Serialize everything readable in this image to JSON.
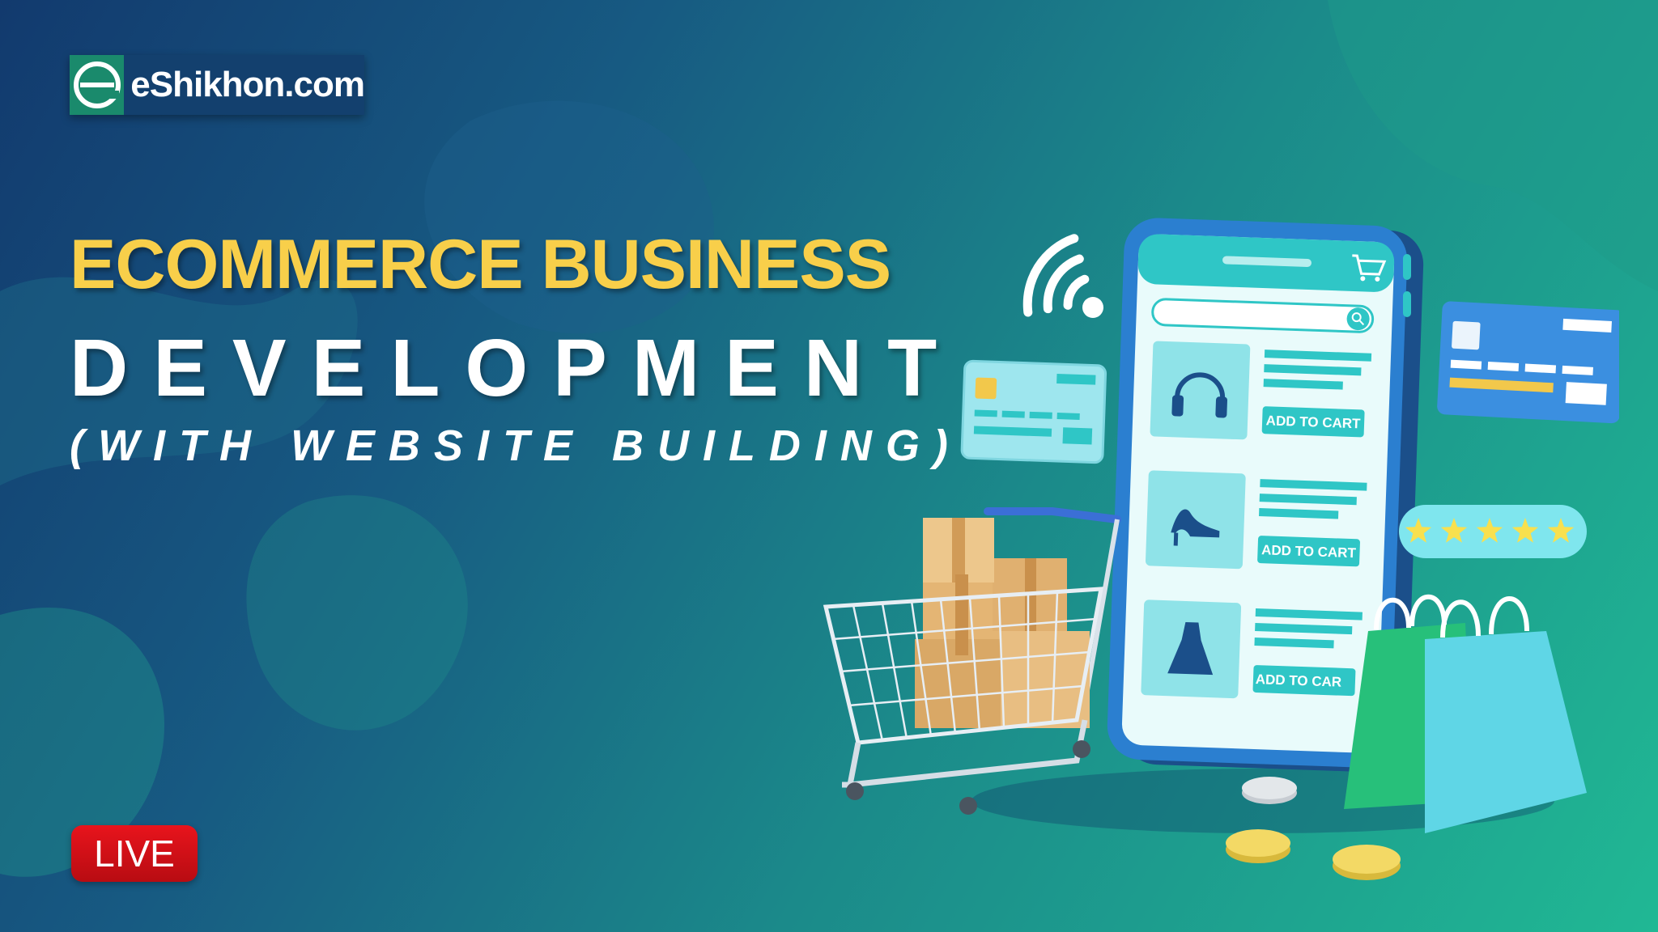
{
  "brand": {
    "logo_text": "eShikhon.com"
  },
  "headline": {
    "line1": "ECOMMERCE BUSINESS",
    "line2": "DEVELOPMENT",
    "line3": "(WITH WEBSITE BUILDING)"
  },
  "badge": {
    "live": "LIVE"
  },
  "phone": {
    "products": [
      {
        "icon": "headphones-icon",
        "button": "ADD TO CART"
      },
      {
        "icon": "high-heel-icon",
        "button": "ADD TO CART"
      },
      {
        "icon": "dress-icon",
        "button": "ADD TO CAR"
      }
    ],
    "rating_stars": 5
  },
  "colors": {
    "title_yellow": "#f8cf4a",
    "live_red": "#e8141c",
    "accent_teal": "#2fc6c6",
    "logo_green": "#1a8a6c"
  }
}
